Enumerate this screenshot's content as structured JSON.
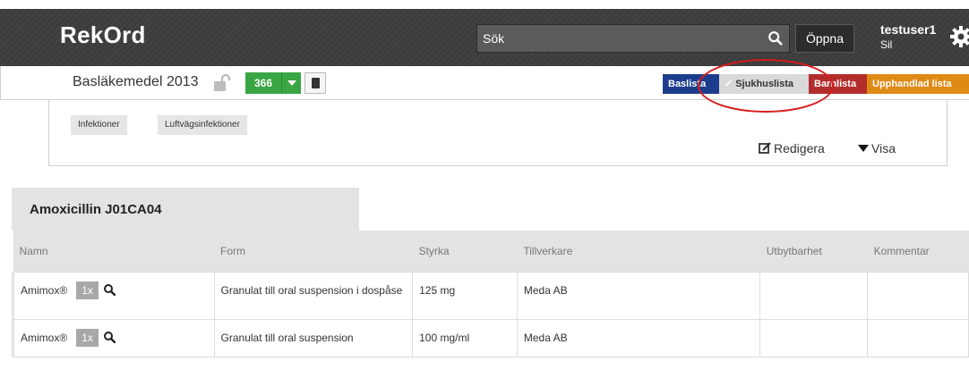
{
  "header": {
    "brand": "RekOrd",
    "search_placeholder": "Sök",
    "open_label": "Öppna",
    "user_name": "testuser1",
    "user_org": "Sil"
  },
  "listbar": {
    "title": "Basläkemedel 2013",
    "count": "366",
    "tabs": [
      {
        "label": "Baslista",
        "color": "#1c3d8c"
      },
      {
        "label": "Sjukhuslista",
        "color": "#d9d9d9",
        "selected": true
      },
      {
        "label": "Barnlista",
        "color": "#b32d2d"
      },
      {
        "label": "Upphandlad lista",
        "color": "#e08a16"
      }
    ]
  },
  "infobox": {
    "tags": [
      "Infektioner",
      "Luftvägsinfektioner"
    ],
    "edit_label": "Redigera",
    "show_label": "Visa"
  },
  "drug": {
    "title": "Amoxicillin J01CA04",
    "columns": [
      "Namn",
      "Form",
      "Styrka",
      "Tillverkare",
      "Utbytbarhet",
      "Kommentar"
    ],
    "rows": [
      {
        "name": "Amimox®",
        "dose": "1x",
        "form": "Granulat till oral suspension i dospåse",
        "strength": "125 mg",
        "manufacturer": "Meda AB",
        "interchangeability": "",
        "comment": ""
      },
      {
        "name": "Amimox®",
        "dose": "1x",
        "form": "Granulat till oral suspension",
        "strength": "100 mg/ml",
        "manufacturer": "Meda AB",
        "interchangeability": "",
        "comment": ""
      }
    ]
  }
}
